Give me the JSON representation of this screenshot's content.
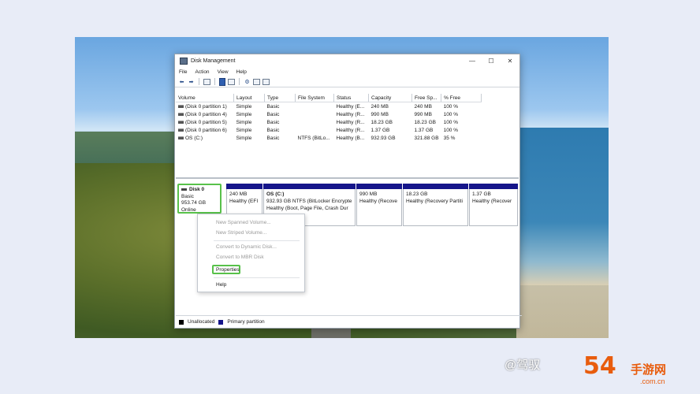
{
  "window": {
    "title": "Disk Management",
    "controls": {
      "minimize": "—",
      "maximize": "☐",
      "close": "✕"
    }
  },
  "menu": [
    "File",
    "Action",
    "View",
    "Help"
  ],
  "volume_table": {
    "columns": [
      "Volume",
      "Layout",
      "Type",
      "File System",
      "Status",
      "Capacity",
      "Free Sp...",
      "% Free"
    ],
    "rows": [
      [
        "(Disk 0 partition 1)",
        "Simple",
        "Basic",
        "",
        "Healthy (E...",
        "240 MB",
        "240 MB",
        "100 %"
      ],
      [
        "(Disk 0 partition 4)",
        "Simple",
        "Basic",
        "",
        "Healthy (R...",
        "990 MB",
        "990 MB",
        "100 %"
      ],
      [
        "(Disk 0 partition 5)",
        "Simple",
        "Basic",
        "",
        "Healthy (R...",
        "18.23 GB",
        "18.23 GB",
        "100 %"
      ],
      [
        "(Disk 0 partition 6)",
        "Simple",
        "Basic",
        "",
        "Healthy (R...",
        "1.37 GB",
        "1.37 GB",
        "100 %"
      ],
      [
        "OS (C:)",
        "Simple",
        "Basic",
        "NTFS (BitLo...",
        "Healthy (B...",
        "932.93 GB",
        "321.88 GB",
        "35 %"
      ]
    ]
  },
  "disk": {
    "name": "Disk 0",
    "type": "Basic",
    "size": "953.74 GB",
    "status": "Online"
  },
  "partitions": [
    {
      "line1": "",
      "line2": "240 MB",
      "line3": "Healthy (EFI"
    },
    {
      "line1": "OS  (C:)",
      "line2": "932.93 GB NTFS (BitLocker Encrypte",
      "line3": "Healthy (Boot, Page File, Crash Dur"
    },
    {
      "line1": "",
      "line2": "990 MB",
      "line3": "Healthy (Recove"
    },
    {
      "line1": "",
      "line2": "18.23 GB",
      "line3": "Healthy (Recovery Partiti"
    },
    {
      "line1": "",
      "line2": "1.37 GB",
      "line3": "Healthy (Recover"
    }
  ],
  "context_menu": {
    "new_spanned": "New Spanned Volume...",
    "new_striped": "New Striped Volume...",
    "convert_dynamic": "Convert to Dynamic Disk...",
    "convert_mbr": "Convert to MBR Disk",
    "properties": "Properties",
    "help": "Help"
  },
  "legend": [
    {
      "label": "Unallocated",
      "color": "#000000"
    },
    {
      "label": "Primary partition",
      "color": "#15158a"
    }
  ],
  "watermark": {
    "text": "@驾驭",
    "logo": "54",
    "brand": "手游网",
    "domain": ".com.cn"
  },
  "colors": {
    "highlight": "#58c14a",
    "primary_partition": "#15158a"
  }
}
